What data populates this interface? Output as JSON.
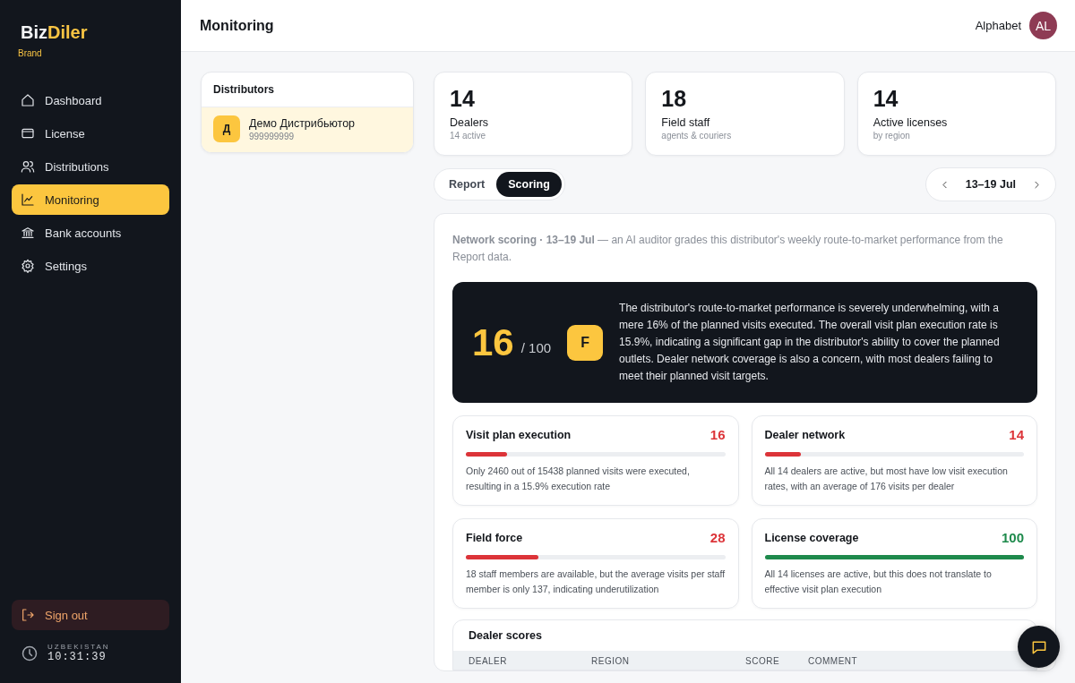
{
  "brand": {
    "name": [
      "Biz",
      "Diler"
    ],
    "subtitle": "Brand"
  },
  "sidebar": {
    "items": [
      {
        "label": "Dashboard",
        "selected": false
      },
      {
        "label": "License",
        "selected": false
      },
      {
        "label": "Distributions",
        "selected": false
      },
      {
        "label": "Monitoring",
        "selected": true
      },
      {
        "label": "Bank accounts",
        "selected": false
      },
      {
        "label": "Settings",
        "selected": false
      }
    ],
    "sign_out": "Sign out",
    "clock": {
      "region": "UZBEKISTAN",
      "time": "10:31:39"
    }
  },
  "header": {
    "title": "Monitoring",
    "user": "Alphabet",
    "avatar": "AL"
  },
  "distributors": {
    "title": "Distributors",
    "items": [
      {
        "avatar": "Д",
        "name": "Демо Дистрибьютор",
        "phone": "999999999",
        "selected": true
      }
    ]
  },
  "stats": [
    {
      "value": "14",
      "label": "Dealers",
      "sub": "14 active"
    },
    {
      "value": "18",
      "label": "Field staff",
      "sub": "agents & couriers"
    },
    {
      "value": "14",
      "label": "Active licenses",
      "sub": "by region"
    }
  ],
  "tabs": [
    {
      "label": "Report",
      "selected": false
    },
    {
      "label": "Scoring",
      "selected": true
    }
  ],
  "week": {
    "label": "13–19 Jul"
  },
  "scoring": {
    "intro": "**Network scoring · 13–19 Jul** — an AI auditor grades this distributor's weekly route-to-market performance from the Report data.",
    "score": "16",
    "max": "/ 100",
    "grade": "F",
    "summary": "The distributor's route-to-market performance is severely underwhelming, with a mere 16% of the planned visits executed. The overall visit plan execution rate is 15.9%, indicating a significant gap in the distributor's ability to cover the planned outlets. Dealer network coverage is also a concern, with most dealers failing to meet their planned visit targets.",
    "metrics": [
      {
        "title": "Visit plan execution",
        "score": "16",
        "level": 0.16,
        "color": "#dc3439",
        "comment": "Only 2460 out of 15438 planned visits were executed, resulting in a 15.9% execution rate"
      },
      {
        "title": "Dealer network",
        "score": "14",
        "level": 0.14,
        "color": "#dc3439",
        "comment": "All 14 dealers are active, but most have low visit execution rates, with an average of 176 visits per dealer"
      },
      {
        "title": "Field force",
        "score": "28",
        "level": 0.28,
        "color": "#dc3439",
        "comment": "18 staff members are available, but the average visits per staff member is only 137, indicating underutilization"
      },
      {
        "title": "License coverage",
        "score": "100",
        "level": 1,
        "color": "#1e8a4c",
        "comment": "All 14 licenses are active, but this does not translate to effective visit plan execution"
      }
    ],
    "dealer_scores": {
      "title": "Dealer scores",
      "columns": [
        "DEALER",
        "REGION",
        "SCORE",
        "COMMENT"
      ]
    }
  }
}
